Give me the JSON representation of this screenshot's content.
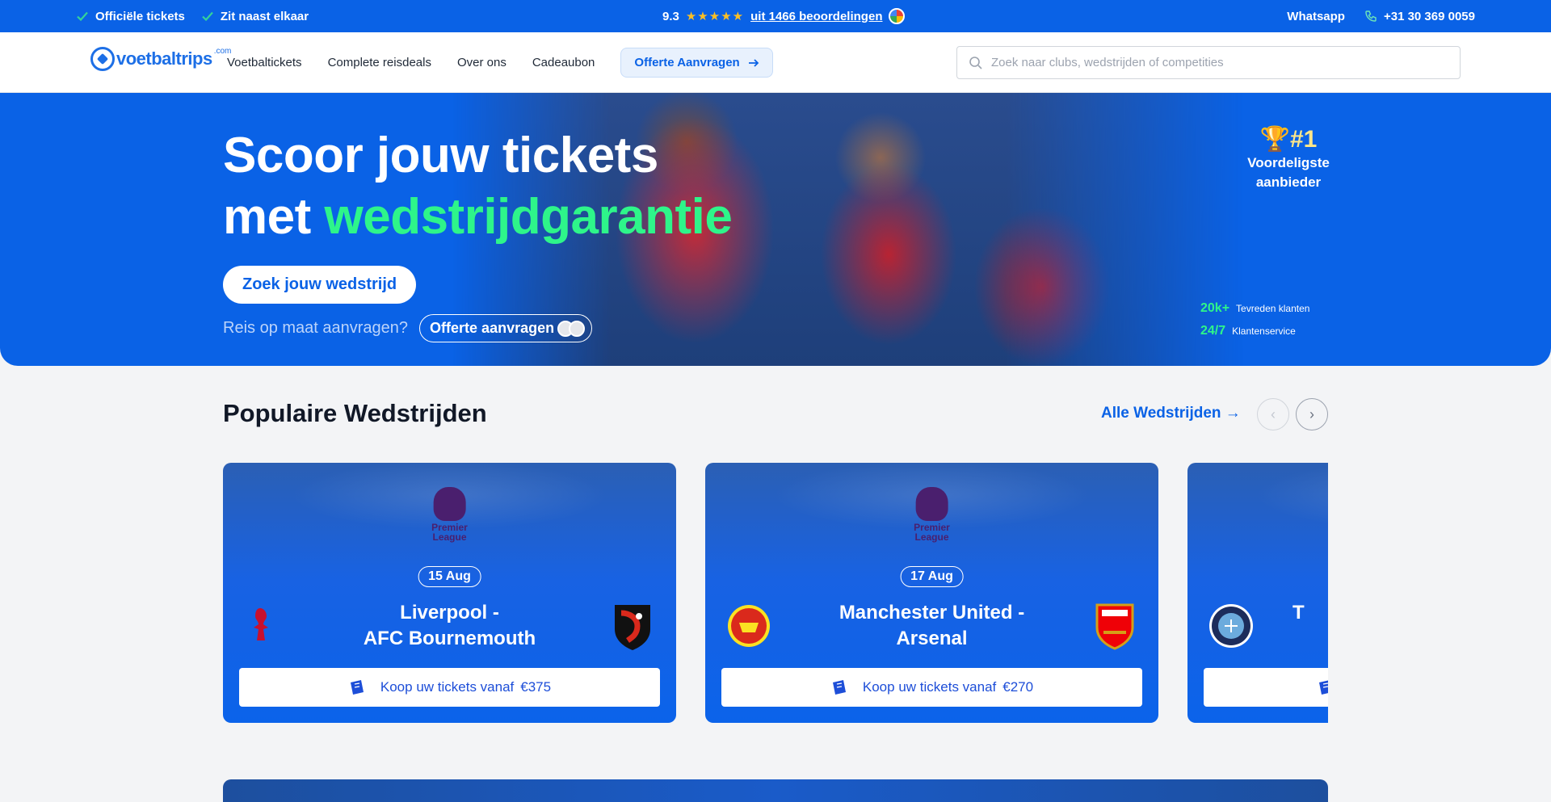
{
  "topbar": {
    "usps": [
      "Officiële tickets",
      "Zit naast elkaar"
    ],
    "rating": "9.3",
    "reviews_link": "uit 1466 beoordelingen",
    "whatsapp": "Whatsapp",
    "phone": "+31 30 369 0059"
  },
  "nav": {
    "logo_word": "voetbaltrips",
    "logo_suffix": ".com",
    "items": [
      "Voetbaltickets",
      "Complete reisdeals",
      "Over ons",
      "Cadeaubon"
    ],
    "cta": "Offerte Aanvragen",
    "search_placeholder": "Zoek naar clubs, wedstrijden of competities"
  },
  "hero": {
    "line1": "Scoor jouw tickets",
    "line2_prefix": "met",
    "line2_accent": "wedstrijdgarantie",
    "primary_button": "Zoek jouw wedstrijd",
    "quote_question": "Reis op maat aanvragen?",
    "quote_button": "Offerte aanvragen",
    "rank_number": "#1",
    "rank_label_1": "Voordeligste",
    "rank_label_2": "aanbieder",
    "stats": [
      {
        "value": "20k+",
        "label": "Tevreden klanten"
      },
      {
        "value": "24/7",
        "label": "Klantenservice"
      }
    ]
  },
  "popular": {
    "title": "Populaire Wedstrijden",
    "all_link": "Alle Wedstrijden →",
    "prev": "‹",
    "next": "›",
    "league_line1": "Premier",
    "league_line2": "League",
    "matches": [
      {
        "date": "15 Aug",
        "home": "Liverpool -",
        "away": "AFC Bournemouth",
        "buy_label": "Koop uw tickets vanaf",
        "price": "€375",
        "home_color": "#c8102e",
        "away_color": "#da291c"
      },
      {
        "date": "17 Aug",
        "home": "Manchester United -",
        "away": "Arsenal",
        "buy_label": "Koop uw tickets vanaf",
        "price": "€270",
        "home_color": "#da291c",
        "away_color": "#ef0107"
      },
      {
        "date": "",
        "home": "T",
        "away": "",
        "buy_label": "",
        "price": "",
        "home_color": "#6cabdd",
        "away_color": "#ffffff"
      }
    ]
  },
  "colors": {
    "brand": "#0a62e6",
    "accent_green": "#2ef58a"
  }
}
